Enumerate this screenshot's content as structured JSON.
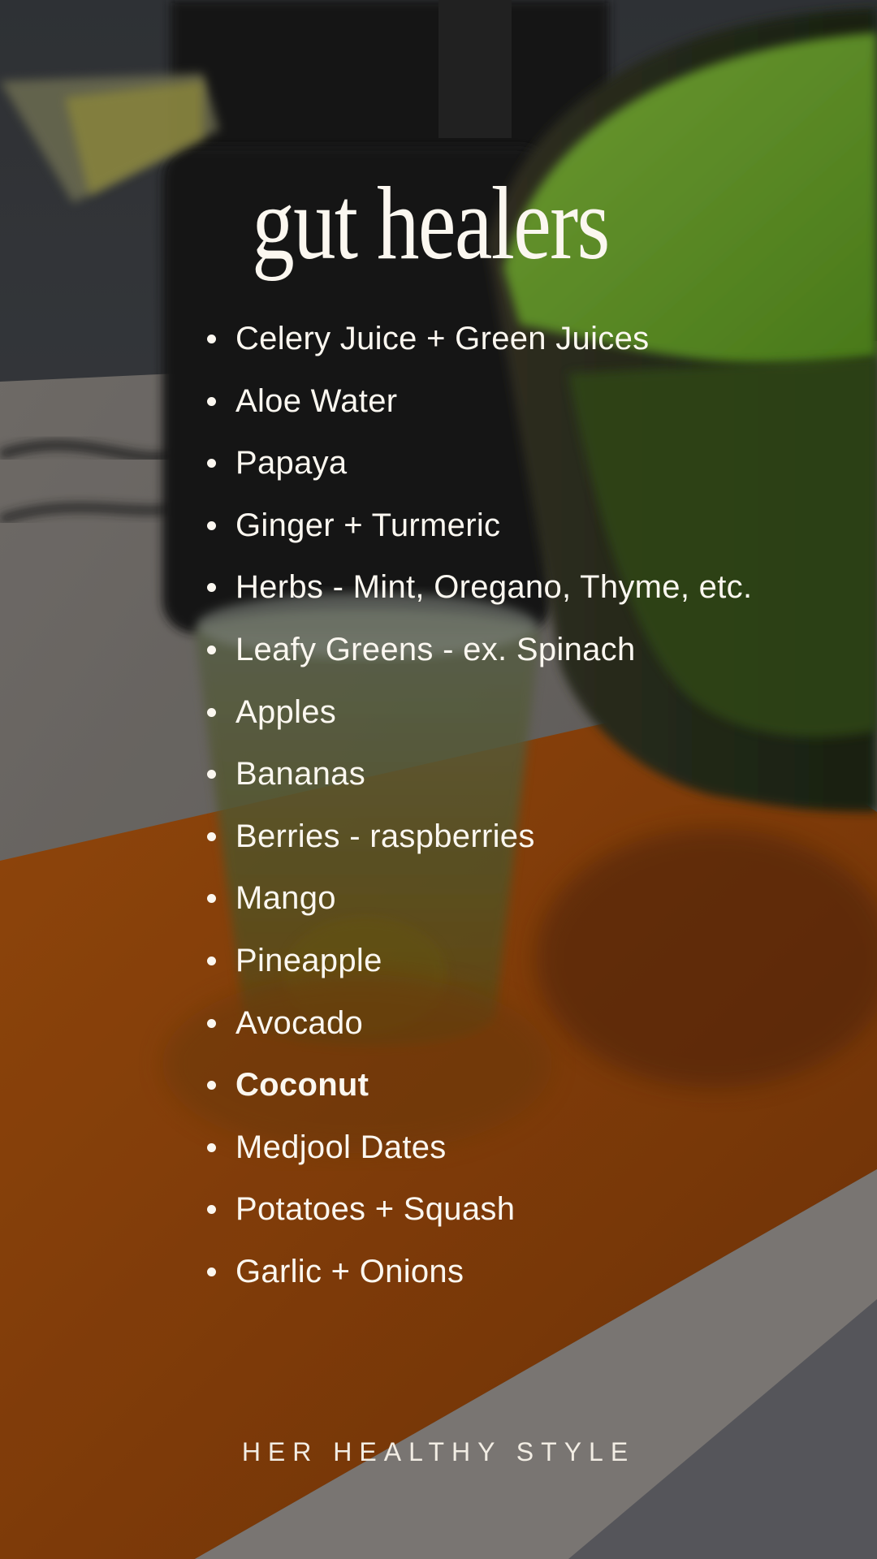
{
  "title": "gut healers",
  "items": [
    "Celery Juice + Green Juices",
    "Aloe Water",
    "Papaya",
    "Ginger + Turmeric",
    "Herbs - Mint, Oregano, Thyme, etc.",
    "Leafy Greens - ex. Spinach",
    "Apples",
    "Bananas",
    "Berries - raspberries",
    "Mango",
    "Pineapple",
    "Avocado",
    "Coconut",
    "Medjool Dates",
    "Potatoes + Squash",
    "Garlic + Onions"
  ],
  "footer": "HER HEALTHY STYLE",
  "colors": {
    "text": "#fbf7f0",
    "orange_mat": "#c8630f",
    "juice_green": "#6fae2c",
    "counter": "#9a9590"
  }
}
